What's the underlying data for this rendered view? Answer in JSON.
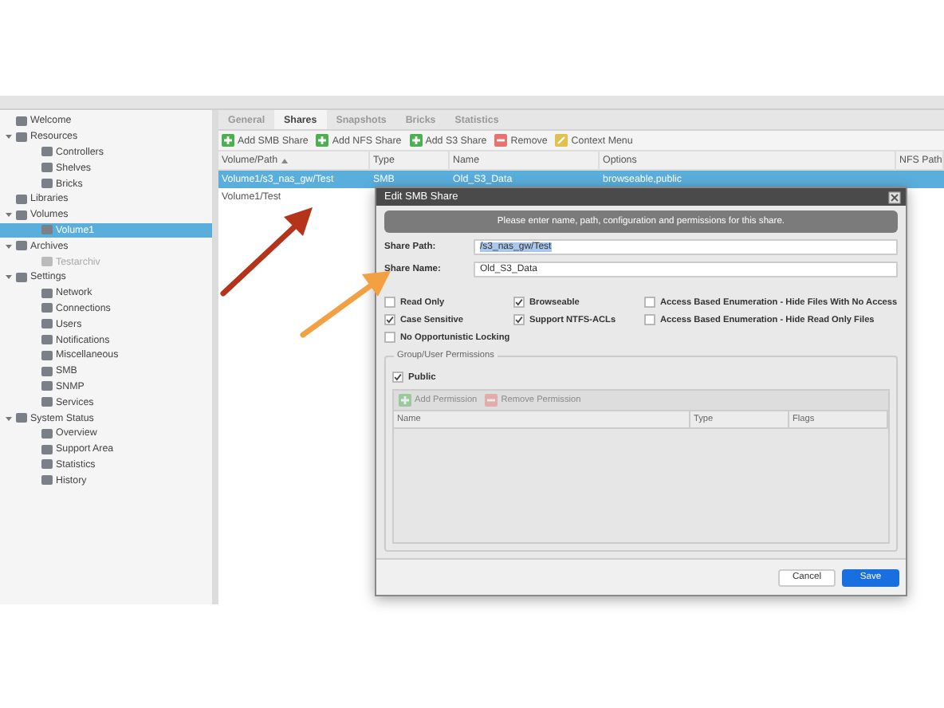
{
  "sidebar": {
    "items": [
      {
        "label": "Welcome",
        "selected": false,
        "disabled": false
      },
      {
        "label": "Resources",
        "selected": false,
        "disabled": false,
        "expanded": true,
        "children": [
          {
            "label": "Controllers",
            "selected": false,
            "disabled": false
          },
          {
            "label": "Shelves",
            "selected": false,
            "disabled": false
          },
          {
            "label": "Bricks",
            "selected": false,
            "disabled": false
          }
        ]
      },
      {
        "label": "Libraries",
        "selected": false,
        "disabled": false
      },
      {
        "label": "Volumes",
        "selected": false,
        "disabled": false,
        "expanded": true,
        "children": [
          {
            "label": "Volume1",
            "selected": true,
            "disabled": false
          }
        ]
      },
      {
        "label": "Archives",
        "selected": false,
        "disabled": false,
        "expanded": true,
        "children": [
          {
            "label": "Testarchiv",
            "selected": false,
            "disabled": true
          }
        ]
      },
      {
        "label": "Settings",
        "selected": false,
        "disabled": false,
        "expanded": true,
        "children": [
          {
            "label": "Network",
            "selected": false,
            "disabled": false
          },
          {
            "label": "Connections",
            "selected": false,
            "disabled": false
          },
          {
            "label": "Users",
            "selected": false,
            "disabled": false
          },
          {
            "label": "Notifications",
            "selected": false,
            "disabled": false
          },
          {
            "label": "Miscellaneous",
            "selected": false,
            "disabled": false
          },
          {
            "label": "SMB",
            "selected": false,
            "disabled": false
          },
          {
            "label": "SNMP",
            "selected": false,
            "disabled": false
          },
          {
            "label": "Services",
            "selected": false,
            "disabled": false
          }
        ]
      },
      {
        "label": "System Status",
        "selected": false,
        "disabled": false,
        "expanded": true,
        "children": [
          {
            "label": "Overview",
            "selected": false,
            "disabled": false
          },
          {
            "label": "Support Area",
            "selected": false,
            "disabled": false
          },
          {
            "label": "Statistics",
            "selected": false,
            "disabled": false
          },
          {
            "label": "History",
            "selected": false,
            "disabled": false
          }
        ]
      }
    ]
  },
  "tabs": [
    {
      "label": "General",
      "selected": false
    },
    {
      "label": "Shares",
      "selected": true
    },
    {
      "label": "Snapshots",
      "selected": false
    },
    {
      "label": "Bricks",
      "selected": false
    },
    {
      "label": "Statistics",
      "selected": false
    }
  ],
  "toolbar": [
    {
      "label": "Add SMB Share",
      "kind": "add"
    },
    {
      "label": "Add NFS Share",
      "kind": "add"
    },
    {
      "label": "Add S3 Share",
      "kind": "add"
    },
    {
      "label": "Remove",
      "kind": "remove"
    },
    {
      "label": "Context Menu",
      "kind": "menu"
    }
  ],
  "table": {
    "columns": [
      "Volume/Path",
      "Type",
      "Name",
      "Options",
      "NFS Path"
    ],
    "rows": [
      {
        "cells": [
          "Volume1/s3_nas_gw/Test",
          "SMB",
          "Old_S3_Data",
          "browseable,public"
        ],
        "selected": true
      },
      {
        "cells": [
          "Volume1/Test"
        ],
        "selected": false
      }
    ]
  },
  "dialog": {
    "title": "Edit SMB Share",
    "banner": "Please enter name, path, configuration and permissions for this share.",
    "fields": [
      {
        "label": "Share Path:",
        "value": "/s3_nas_gw/Test",
        "highlighted": true
      },
      {
        "label": "Share Name:",
        "value": "Old_S3_Data",
        "highlighted": false
      }
    ],
    "options": [
      {
        "label": "Read Only",
        "checked": false
      },
      {
        "label": "Browseable",
        "checked": true
      },
      {
        "label": "Access Based Enumeration - Hide Files With No Access",
        "checked": false
      },
      {
        "label": "Case Sensitive",
        "checked": true
      },
      {
        "label": "Support NTFS-ACLs",
        "checked": true
      },
      {
        "label": "Access Based Enumeration - Hide Read Only Files",
        "checked": false
      },
      {
        "label": "No Opportunistic Locking",
        "checked": false
      }
    ],
    "permissions": {
      "legend": "Group/User Permissions",
      "public": {
        "label": "Public",
        "checked": true
      },
      "toolbar": [
        {
          "label": "Add Permission",
          "kind": "add",
          "disabled": true
        },
        {
          "label": "Remove Permission",
          "kind": "remove",
          "disabled": true
        }
      ],
      "columns": [
        "Name",
        "Type",
        "Flags"
      ]
    },
    "buttons": [
      {
        "label": "Cancel",
        "kind": "secondary"
      },
      {
        "label": "Save",
        "kind": "primary"
      }
    ]
  }
}
